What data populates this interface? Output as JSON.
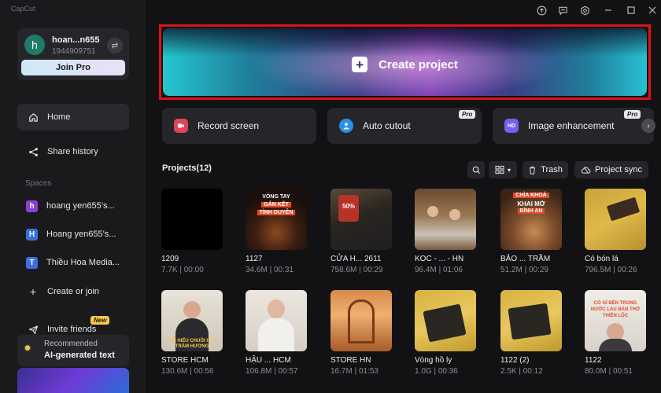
{
  "app": {
    "title": "CapCut"
  },
  "colors": {
    "accent_red": "#e01212",
    "join_pro_bg": "#d8e7f6",
    "sidebar_bg": "#1a1a1d"
  },
  "account": {
    "initial": "h",
    "name": "hoan...n655",
    "id": "1944909751",
    "join_pro_label": "Join Pro"
  },
  "sidebar": {
    "nav": [
      {
        "label": "Home",
        "icon": "home-icon"
      },
      {
        "label": "Share history",
        "icon": "share-icon"
      }
    ],
    "spaces_label": "Spaces",
    "spaces": [
      {
        "badge": "h",
        "label": "hoang yen655’s...",
        "color": "#8b3fd6"
      },
      {
        "badge": "H",
        "label": "Hoang yen655’s...",
        "color": "#3b6fe0"
      },
      {
        "badge": "T",
        "label": "Thiều Hoa Media...",
        "color": "#3b6fe0"
      }
    ],
    "create_or_join": "Create or join",
    "invite_friends": "Invite friends",
    "new_badge": "New",
    "recommend_line1": "Recommended",
    "recommend_line2": "AI-generated text"
  },
  "main": {
    "create_label": "Create project",
    "tools": [
      {
        "label": "Record screen",
        "icon": "record-icon",
        "pro": false
      },
      {
        "label": "Auto cutout",
        "icon": "person-icon",
        "pro": true
      },
      {
        "label": "Image enhancement",
        "icon": "hd-icon",
        "pro": true
      }
    ],
    "pro_badge": "Pro",
    "projects_title": "Projects(12)",
    "trash_label": "Trash",
    "sync_label": "Project sync",
    "projects": [
      {
        "name": "1209",
        "meta": "7.7K | 00:00"
      },
      {
        "name": "1127",
        "meta": "34.6M | 00:31",
        "thumb_text": [
          "VÒNG TAY",
          "GẮN KẾT",
          "TÌNH DUYÊN"
        ]
      },
      {
        "name": "CỬA H... 2611",
        "meta": "758.6M | 00:29",
        "thumb_text": [
          "50%"
        ]
      },
      {
        "name": "KOC - ... - HN",
        "meta": "96.4M | 01:06"
      },
      {
        "name": "BẢO ... TRẦM",
        "meta": "51.2M | 00:29",
        "thumb_text": [
          "CHÌA KHOÁ",
          "KHAI MỞ",
          "BÌNH AN"
        ]
      },
      {
        "name": "Có bón lá",
        "meta": "796.5M | 00:26"
      },
      {
        "name": "STORE HCM",
        "meta": "130.6M | 00:56",
        "thumb_text": [
          "TÌM HIỂU CHUỖI HẠT",
          "TRẦM HƯƠNG"
        ]
      },
      {
        "name": "HẬU ... HCM",
        "meta": "106.8M | 00:57"
      },
      {
        "name": "STORE HN",
        "meta": "16.7M | 01:53"
      },
      {
        "name": "Vòng hồ ly",
        "meta": "1.0G | 00:36"
      },
      {
        "name": "1122 (2)",
        "meta": "2.5K | 00:12"
      },
      {
        "name": "1122",
        "meta": "80.0M | 00:51",
        "thumb_text": [
          "CÓ GÌ BÊN TRONG",
          "NƯỚC LAU BÀN THỜ",
          "THIÊN LỘC"
        ]
      }
    ]
  }
}
